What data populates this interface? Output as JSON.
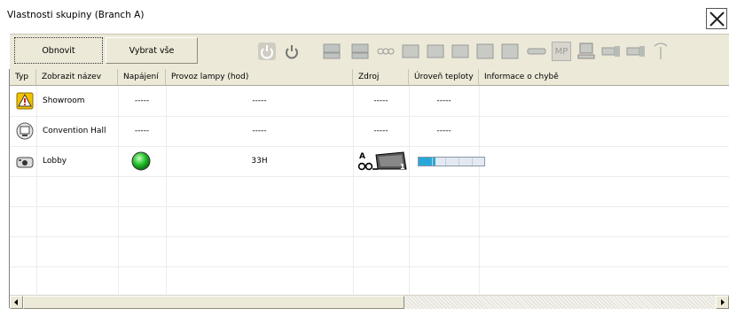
{
  "window": {
    "title": "Vlastnosti skupiny (Branch A)"
  },
  "toolbar": {
    "refresh_label": "Obnovit",
    "select_all_label": "Vybrat vše",
    "icon_labels": {
      "monitor_label": "MP"
    }
  },
  "table": {
    "columns": [
      "Typ",
      "Zobrazit název",
      "Napájení",
      "Provoz lampy (hod)",
      "Zdroj",
      "Úroveň teploty",
      "Informace o chybě"
    ],
    "rows": [
      {
        "type_icon": "warning-icon",
        "name": "Showroom",
        "power": "-----",
        "lamp_hours": "-----",
        "source": "-----",
        "temperature": "-----",
        "error_info": ""
      },
      {
        "type_icon": "monitor-icon",
        "name": "Convention Hall",
        "power": "-----",
        "lamp_hours": "-----",
        "source": "-----",
        "temperature": "-----",
        "error_info": ""
      },
      {
        "type_icon": "projector-icon",
        "name": "Lobby",
        "power_icon": "power-on-green-icon",
        "lamp_hours": "33H",
        "source_icon": "computer-input-icon",
        "source_badge_a": "A",
        "source_badge_n": "1",
        "temperature_level": 0.25,
        "error_info": ""
      }
    ]
  },
  "colors": {
    "toolbar_bg": "#ece9d8",
    "power_on": "#22c02b",
    "temp_fill": "#2aa7d8",
    "warning": "#f2c200"
  }
}
